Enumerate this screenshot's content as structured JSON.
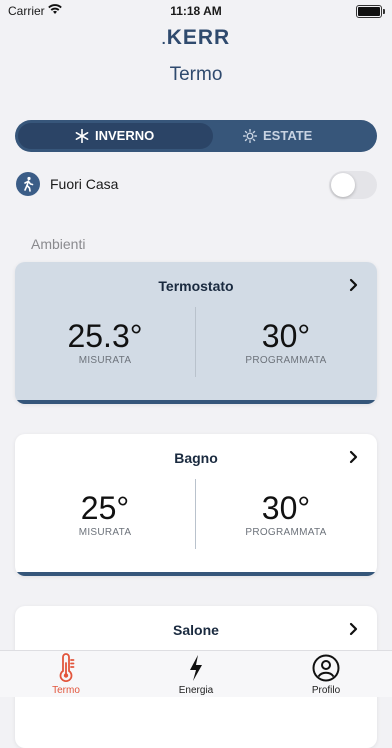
{
  "status_bar": {
    "carrier": "Carrier",
    "time": "11:18 AM"
  },
  "header": {
    "logo": "KERR",
    "title": "Termo"
  },
  "mode_switch": {
    "active": "inverno",
    "options": [
      {
        "label": "INVERNO",
        "icon": "snowflake-icon"
      },
      {
        "label": "ESTATE",
        "icon": "sun-icon"
      }
    ]
  },
  "away": {
    "label": "Fuori Casa",
    "enabled": false,
    "icon": "walking-person-icon"
  },
  "ambienti": {
    "title": "Ambienti",
    "rooms": [
      {
        "name": "Termostato",
        "measured": "25.3°",
        "measured_label": "MISURATA",
        "set": "30°",
        "set_label": "PROGRAMMATA",
        "selected": true
      },
      {
        "name": "Bagno",
        "measured": "25°",
        "measured_label": "MISURATA",
        "set": "30°",
        "set_label": "PROGRAMMATA",
        "selected": false
      },
      {
        "name": "Salone"
      }
    ]
  },
  "tabs": [
    {
      "label": "Termo",
      "icon": "thermometer-icon",
      "active": true
    },
    {
      "label": "Energia",
      "icon": "lightning-icon",
      "active": false
    },
    {
      "label": "Profilo",
      "icon": "profile-icon",
      "active": false
    }
  ],
  "colors": {
    "accent": "#2f4a6e",
    "active_tab": "#e2553c",
    "card_selected": "#d2dbe5"
  }
}
